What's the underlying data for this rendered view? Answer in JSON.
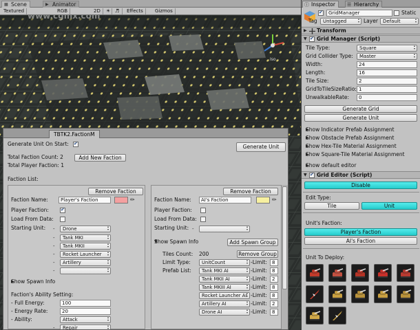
{
  "scene": {
    "tabs": [
      {
        "label": "Scene"
      },
      {
        "label": "Animator"
      }
    ],
    "toolbar": {
      "shading": "Textured",
      "color_mode": "RGB",
      "dim": "2D",
      "effects": "Effects",
      "gizmos": "Gizmos"
    },
    "gizmo_label": "Iso",
    "watermark": "www.cgmx.com"
  },
  "faction_window": {
    "title": "TBTK2.FactionM",
    "generate_unit_on_start_label": "Generate Unit On Start:",
    "generate_unit_on_start": true,
    "generate_unit_button": "Generate Unit",
    "total_faction_count_label": "Total Faction Count: 2",
    "add_new_faction_button": "Add New Faction",
    "total_player_faction_label": "Total Player Faction: 1",
    "faction_list_label": "Faction List:",
    "remove_faction_button": "Remove Faction",
    "faction_name_label": "Faction Name:",
    "player_faction_label": "Player Faction:",
    "load_from_data_label": "Load From Data:",
    "starting_unit_label": "Starting Unit:",
    "show_spawn_info_label": "Show Spawn Info",
    "factions": [
      {
        "name": "Player's Faction",
        "color": "#f4a0a0",
        "player_faction": true,
        "load_from_data": false,
        "starting_units": [
          "Drone",
          "Tank MKI",
          "Tank MKII",
          "Rocket Launcher",
          "Artillery",
          ""
        ]
      },
      {
        "name": "AI's Faction",
        "color": "#f7f0a0",
        "player_faction": false,
        "load_from_data": false,
        "starting_units": [
          ""
        ]
      }
    ],
    "spawn": {
      "add_spawn_group_button": "Add Spawn Group",
      "tiles_count_label": "Tiles Count:",
      "tiles_count": "200",
      "remove_group_button": "Remove Group",
      "limit_type_label": "Limit Type:",
      "limit_type": "UnitCount",
      "limit_label": "-Limit:",
      "limit": "8",
      "prefab_list_label": "Prefab List:",
      "prefabs": [
        {
          "name": "Tank MKI AI",
          "limit": "8"
        },
        {
          "name": "Tank MKII AI",
          "limit": "2"
        },
        {
          "name": "Tank MKIII AI",
          "limit": "8"
        },
        {
          "name": "Rocket Launcher AI",
          "limit": "8"
        },
        {
          "name": "Artillery AI",
          "limit": "2"
        },
        {
          "name": "Drone AI",
          "limit": "8"
        }
      ]
    },
    "ability": {
      "label": "Faction's Ability Setting:",
      "full_energy_label": "- Full Energy:",
      "full_energy": "100",
      "energy_rate_label": "- Energy Rate:",
      "energy_rate": "20",
      "ability_label": "- Ability:",
      "abilities": [
        "Attack",
        "Repair"
      ]
    }
  },
  "inspector": {
    "tabs": [
      {
        "label": "Inspector"
      },
      {
        "label": "Hierarchy"
      }
    ],
    "object_name": "GridManager",
    "static_label": "Static",
    "tag_label": "Tag",
    "tag_value": "Untagged",
    "layer_label": "Layer",
    "layer_value": "Default",
    "transform_label": "Transform",
    "script_label": "Grid Manager (Script)",
    "fields": [
      {
        "label": "Tile Type:",
        "value": "Square"
      },
      {
        "label": "Grid Collider Type:",
        "value": "Master"
      },
      {
        "label": "Width:",
        "value": "24"
      },
      {
        "label": "Length:",
        "value": "16"
      },
      {
        "label": "Tile Size:",
        "value": "2"
      },
      {
        "label": "GridToTileSizeRatio:",
        "value": "1"
      },
      {
        "label": "UnwalkableRate:",
        "value": "0"
      }
    ],
    "generate_grid_button": "Generate Grid",
    "generate_unit_button": "Generate Unit",
    "foldouts": [
      "Show Indicator Prefab Assignment",
      "Show Obstacle Prefab Assignment",
      "Show Hex-Tile Material Assignment",
      "Show Square-Tile Material Assignment"
    ],
    "show_default_editor": "Show default editor",
    "grid_editor_label": "Grid Editor (Script)",
    "disable_button": "Disable",
    "edit_type_label": "Edit Type:",
    "tile_button": "Tile",
    "unit_button": "Unit",
    "units_faction_label": "Unit's Faction:",
    "players_faction_button": "Player's Faction",
    "ais_faction_button": "AI's Faction",
    "unit_to_deploy_label": "Unit To Deploy:",
    "unit_icons": [
      {
        "name": "tank-red-icon",
        "color": "#c23a2a"
      },
      {
        "name": "tank-red-icon",
        "color": "#c25040"
      },
      {
        "name": "tank-red-icon",
        "color": "#b53325"
      },
      {
        "name": "tank-red-icon",
        "color": "#c8302a"
      },
      {
        "name": "tank-red-icon",
        "color": "#b83a30"
      },
      {
        "name": "jet-red-icon",
        "color": "#c23a2a"
      },
      {
        "name": "tank-gold-icon",
        "color": "#c9a040"
      },
      {
        "name": "tank-gold-icon",
        "color": "#b8913a"
      },
      {
        "name": "tank-gold-icon",
        "color": "#c9a040"
      },
      {
        "name": "tank-gold-icon",
        "color": "#b8913a"
      },
      {
        "name": "tank-gold-icon",
        "color": "#d0a848"
      },
      {
        "name": "jet-gold-icon",
        "color": "#d0a848"
      }
    ]
  }
}
